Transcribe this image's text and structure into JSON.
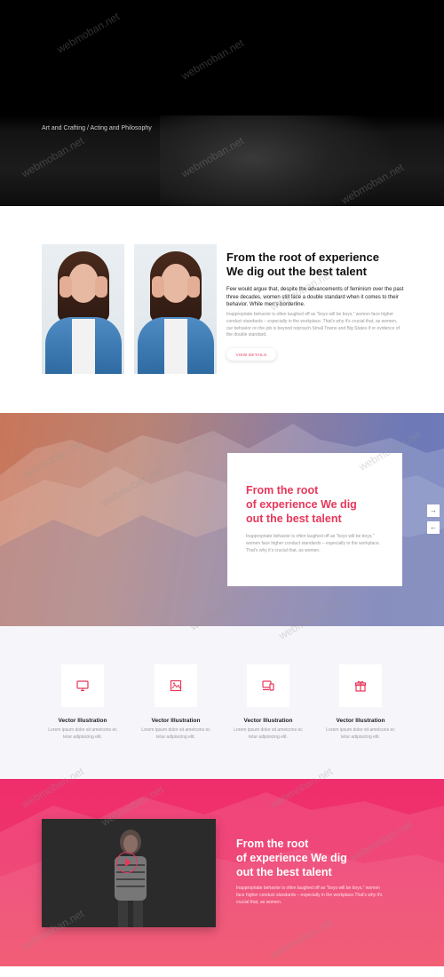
{
  "hero": {
    "breadcrumb": "Art and Crafting / Acting and Philosophy"
  },
  "about": {
    "title_line1": "From the root of experience",
    "title_line2": "We dig out the best talent",
    "lead": "Few would argue that, despite the advancements of feminism over the past three decades, women still face a double standard when it comes to their behavior. While men's borderline.",
    "body": "Inappropriate behavior is often laughed off as \"boys will be boys,\" women face higher conduct standards – especially in the workplace. That's why it's crucial that, as women, our behavior on the job is beyond reproach.Small Towns and Big States if or evidence of the double standard.",
    "button": "VIEW DETAILS"
  },
  "slider": {
    "title_line1": "From the root",
    "title_line2": "of experience We dig",
    "title_line3": "out the best talent",
    "body": "Inappropriate behavior is often laughed off as \"boys will be boys,\" women face higher conduct standards – especially in the workplace. That's why it's crucial that, as women.",
    "next_arrow": "→",
    "prev_arrow": "←"
  },
  "features": {
    "items": [
      {
        "icon": "monitor-icon",
        "title": "Vector Illustration",
        "text": "Lorem ipsum dolor sit ametcons ec tetur adipisicing elit."
      },
      {
        "icon": "image-icon",
        "title": "Vector Illustration",
        "text": "Lorem ipsum dolor sit ametcons ec tetur adipisicing elit."
      },
      {
        "icon": "devices-icon",
        "title": "Vector Illustration",
        "text": "Lorem ipsum dolor sit ametcons ec tetur adipisicing elit."
      },
      {
        "icon": "gift-icon",
        "title": "Vector Illustration",
        "text": "Lorem ipsum dolor sit ametcons ec tetur adipisicing elit."
      }
    ]
  },
  "video": {
    "title_line1": "From the root",
    "title_line2": "of experience We dig",
    "title_line3": "out the best talent",
    "body": "Inappropriate behavior is often laughed off as \"boys will be boys,\" women face higher conduct standards – especially in the workplace.That's why it's crucial that, as women."
  },
  "watermark": "webmoban.net",
  "colors": {
    "accent": "#e8375b",
    "dark": "#000000",
    "feature_bg": "#f6f6fa",
    "video_bg": "#ef2e6d"
  }
}
